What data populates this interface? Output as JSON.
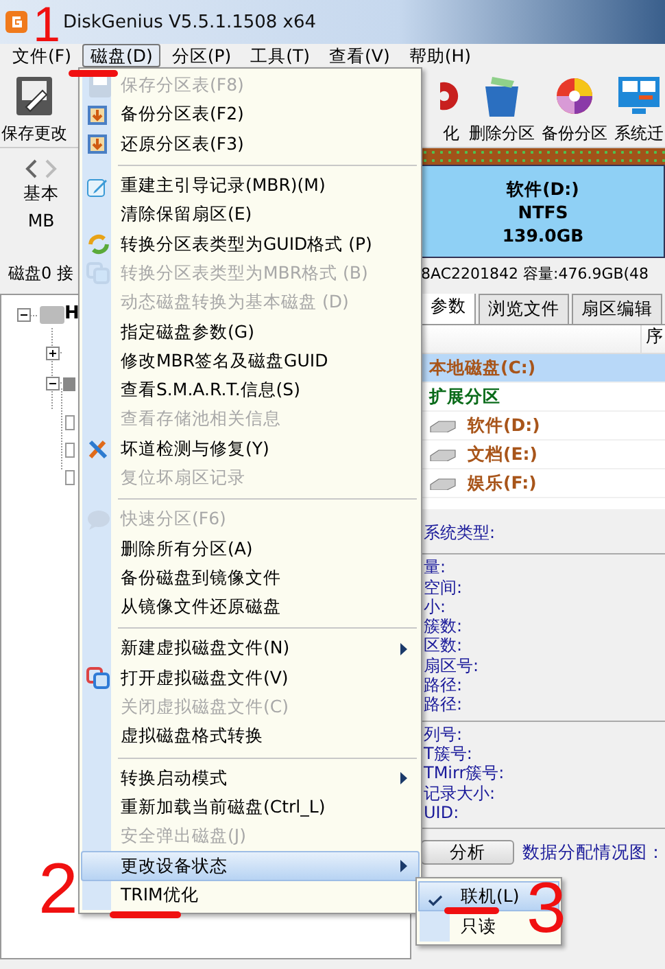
{
  "window": {
    "title": "DiskGenius V5.5.1.1508 x64"
  },
  "menu_bar": [
    {
      "label": "文件(F)",
      "selected": false
    },
    {
      "label": "磁盘(D)",
      "selected": true
    },
    {
      "label": "分区(P)",
      "selected": false
    },
    {
      "label": "工具(T)",
      "selected": false
    },
    {
      "label": "查看(V)",
      "selected": false
    },
    {
      "label": "帮助(H)",
      "selected": false
    }
  ],
  "toolbar": [
    {
      "label": "保存更改"
    },
    {
      "label": "化"
    },
    {
      "label": "删除分区"
    },
    {
      "label": "备份分区"
    },
    {
      "label": "系统迁"
    }
  ],
  "disk_nav": {
    "line_1": "基本",
    "line_2": "MB"
  },
  "partition_block": {
    "name": "软件(D:)",
    "filesystem": "NTFS",
    "size": "139.0GB"
  },
  "disk_info": {
    "left": "磁盘0 接",
    "right": "8AC2201842 容量:476.9GB(48"
  },
  "tree": {
    "root_label": "H"
  },
  "tabs": [
    {
      "label": "参数",
      "selected": true
    },
    {
      "label": "浏览文件",
      "selected": false
    },
    {
      "label": "扇区编辑",
      "selected": false
    }
  ],
  "table": {
    "column_2": "序",
    "rows": [
      {
        "label": "本地磁盘(C:)",
        "selected": true,
        "color": "#a8551a",
        "children": []
      },
      {
        "label": "扩展分区",
        "selected": false,
        "color": "#0a6b1a",
        "children": [
          {
            "label": "软件(D:)",
            "selected": false,
            "color": "#a8551a"
          },
          {
            "label": "文档(E:)",
            "selected": false,
            "color": "#a8551a"
          },
          {
            "label": "娱乐(F:)",
            "selected": false,
            "color": "#a8551a"
          }
        ]
      }
    ]
  },
  "details": [
    [
      "系统类型:"
    ],
    [
      "量:",
      "空间:",
      "小:",
      "簇数:",
      "区数:",
      "扇区号:",
      "路径:",
      "路径:"
    ],
    [
      "列号:",
      "T簇号:",
      "TMirr簇号:",
      "记录大小:",
      "UID:"
    ]
  ],
  "analyze_button": "分析",
  "allocation_label": "数据分配情况图：",
  "disk_menu": [
    {
      "kind": "item",
      "label": "保存分区表(F8)",
      "disabled": true,
      "submenu": false,
      "selected": false
    },
    {
      "kind": "item",
      "label": "备份分区表(F2)",
      "disabled": false,
      "submenu": false,
      "selected": false
    },
    {
      "kind": "item",
      "label": "还原分区表(F3)",
      "disabled": false,
      "submenu": false,
      "selected": false
    },
    {
      "kind": "separator"
    },
    {
      "kind": "item",
      "label": "重建主引导记录(MBR)(M)",
      "disabled": false,
      "submenu": false,
      "selected": false
    },
    {
      "kind": "item",
      "label": "清除保留扇区(E)",
      "disabled": false,
      "submenu": false,
      "selected": false
    },
    {
      "kind": "item",
      "label": "转换分区表类型为GUID格式 (P)",
      "disabled": false,
      "submenu": false,
      "selected": false
    },
    {
      "kind": "item",
      "label": "转换分区表类型为MBR格式 (B)",
      "disabled": true,
      "submenu": false,
      "selected": false
    },
    {
      "kind": "item",
      "label": "动态磁盘转换为基本磁盘 (D)",
      "disabled": true,
      "submenu": false,
      "selected": false
    },
    {
      "kind": "item",
      "label": "指定磁盘参数(G)",
      "disabled": false,
      "submenu": false,
      "selected": false
    },
    {
      "kind": "item",
      "label": "修改MBR签名及磁盘GUID",
      "disabled": false,
      "submenu": false,
      "selected": false
    },
    {
      "kind": "item",
      "label": "查看S.M.A.R.T.信息(S)",
      "disabled": false,
      "submenu": false,
      "selected": false
    },
    {
      "kind": "item",
      "label": "查看存储池相关信息",
      "disabled": true,
      "submenu": false,
      "selected": false
    },
    {
      "kind": "item",
      "label": "坏道检测与修复(Y)",
      "disabled": false,
      "submenu": false,
      "selected": false
    },
    {
      "kind": "item",
      "label": "复位坏扇区记录",
      "disabled": true,
      "submenu": false,
      "selected": false
    },
    {
      "kind": "separator"
    },
    {
      "kind": "item",
      "label": "快速分区(F6)",
      "disabled": true,
      "submenu": false,
      "selected": false
    },
    {
      "kind": "item",
      "label": "删除所有分区(A)",
      "disabled": false,
      "submenu": false,
      "selected": false
    },
    {
      "kind": "item",
      "label": "备份磁盘到镜像文件",
      "disabled": false,
      "submenu": false,
      "selected": false
    },
    {
      "kind": "item",
      "label": "从镜像文件还原磁盘",
      "disabled": false,
      "submenu": false,
      "selected": false
    },
    {
      "kind": "separator"
    },
    {
      "kind": "item",
      "label": "新建虚拟磁盘文件(N)",
      "disabled": false,
      "submenu": true,
      "selected": false
    },
    {
      "kind": "item",
      "label": "打开虚拟磁盘文件(V)",
      "disabled": false,
      "submenu": false,
      "selected": false
    },
    {
      "kind": "item",
      "label": "关闭虚拟磁盘文件(C)",
      "disabled": true,
      "submenu": false,
      "selected": false
    },
    {
      "kind": "item",
      "label": "虚拟磁盘格式转换",
      "disabled": false,
      "submenu": false,
      "selected": false
    },
    {
      "kind": "separator"
    },
    {
      "kind": "item",
      "label": "转换启动模式",
      "disabled": false,
      "submenu": true,
      "selected": false
    },
    {
      "kind": "item",
      "label": "重新加载当前磁盘(Ctrl_L)",
      "disabled": false,
      "submenu": false,
      "selected": false
    },
    {
      "kind": "item",
      "label": "安全弹出磁盘(J)",
      "disabled": true,
      "submenu": false,
      "selected": false
    },
    {
      "kind": "item",
      "label": "更改设备状态",
      "disabled": false,
      "submenu": true,
      "selected": true
    },
    {
      "kind": "item",
      "label": "TRIM优化",
      "disabled": false,
      "submenu": false,
      "selected": false
    }
  ],
  "state_submenu": [
    {
      "label": "联机(L)",
      "checked": true,
      "selected": true
    },
    {
      "label": "只读",
      "checked": false,
      "selected": false
    }
  ],
  "annotations": [
    {
      "label": "1"
    },
    {
      "label": "2"
    },
    {
      "label": "3"
    }
  ]
}
